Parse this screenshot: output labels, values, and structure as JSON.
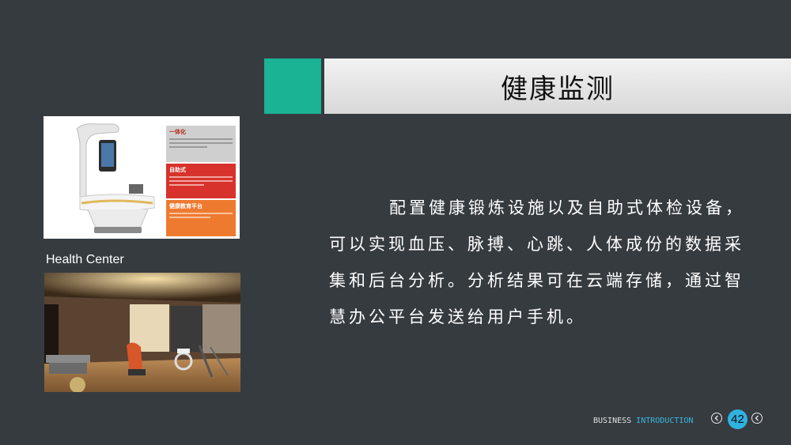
{
  "slide": {
    "title": "健康监测",
    "caption": "Health Center",
    "body": "配置健康锻炼设施以及自助式体检设备，可以实现血压、脉搏、心跳、人体成份的数据采集和后台分析。分析结果可在云端存储，通过智慧办公平台发送给用户手机。"
  },
  "product_panels": [
    {
      "heading": "一体化"
    },
    {
      "heading": "自助式"
    },
    {
      "heading": "健康教育平台"
    }
  ],
  "footer": {
    "word1": "BUSINESS",
    "word2": "INTRODUCTION",
    "page": "42"
  },
  "icons": {
    "prev": "chevron-left-icon",
    "next": "chevron-left-icon"
  },
  "colors": {
    "background": "#363b40",
    "accent": "#1ab394",
    "footer_highlight": "#38b8e0",
    "page_badge": "#2fb2e0"
  }
}
